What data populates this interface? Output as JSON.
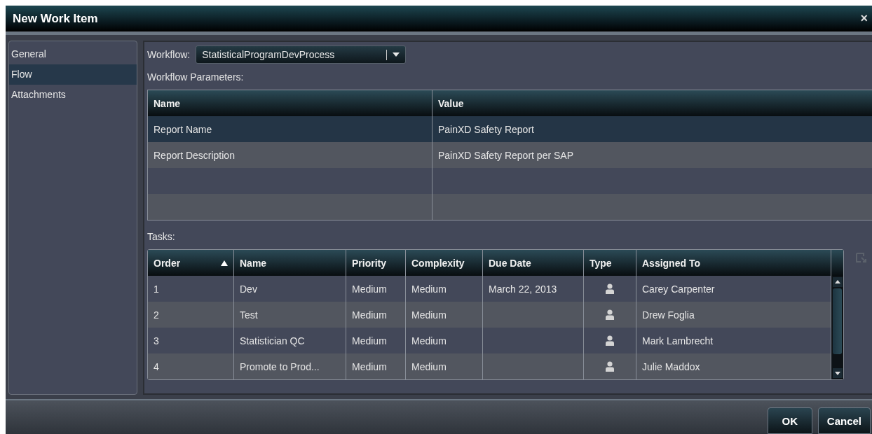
{
  "window": {
    "title": "New Work Item",
    "close": "×"
  },
  "sidebar": {
    "items": [
      {
        "label": "General",
        "selected": false
      },
      {
        "label": "Flow",
        "selected": true
      },
      {
        "label": "Attachments",
        "selected": false
      }
    ]
  },
  "workflow": {
    "label": "Workflow:",
    "value": "StatisticalProgramDevProcess"
  },
  "parameters": {
    "label": "Workflow Parameters:",
    "columns": [
      "Name",
      "Value"
    ],
    "rows": [
      {
        "name": "Report Name",
        "value": "PainXD Safety Report",
        "selected": true
      },
      {
        "name": "Report Description",
        "value": "PainXD Safety Report per SAP",
        "selected": false
      }
    ]
  },
  "tasks": {
    "label": "Tasks:",
    "columns": [
      "Order",
      "Name",
      "Priority",
      "Complexity",
      "Due Date",
      "Type",
      "Assigned To"
    ],
    "rows": [
      {
        "order": "1",
        "name": "Dev",
        "priority": "Medium",
        "complexity": "Medium",
        "due_date": "March 22, 2013",
        "kind": "user",
        "assigned_to": "Carey Carpenter"
      },
      {
        "order": "2",
        "name": "Test",
        "priority": "Medium",
        "complexity": "Medium",
        "kind": "user",
        "assigned_to": "Drew Foglia"
      },
      {
        "order": "3",
        "name": "Statistician QC",
        "priority": "Medium",
        "complexity": "Medium",
        "kind": "user",
        "assigned_to": "Mark Lambrecht"
      },
      {
        "order": "4",
        "name": "Promote to Prod...",
        "priority": "Medium",
        "complexity": "Medium",
        "kind": "user",
        "assigned_to": "Julie Maddox"
      }
    ]
  },
  "buttons": [
    "OK",
    "Cancel"
  ]
}
